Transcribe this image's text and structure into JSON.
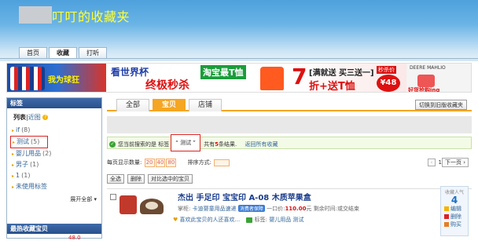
{
  "header": {
    "site_title": "叮叮的收藏夹",
    "nav": [
      "首页",
      "收藏",
      "打听"
    ]
  },
  "banner": {
    "ad1_text": "我为球狂",
    "ad2_line1": "看世界杯",
    "ad2_line2": "终极秒杀",
    "ad2_tag": "淘宝最T恤",
    "ad3_number": "7",
    "ad3_line1": "[满就送 买三送一]",
    "ad3_line2": "折+送T恤",
    "ad3_badge": "秒杀价",
    "ad3_price": "¥48",
    "ad4_brand": "DEERE MAHLIO",
    "ad4_cta": "好货抢购ing"
  },
  "sidebar": {
    "title": "标签",
    "view_list": "列表",
    "view_recent": "近图",
    "tags": [
      {
        "name": "if",
        "count": "(8)"
      },
      {
        "name": "测试",
        "count": "(5)"
      },
      {
        "name": "婴儿用品",
        "count": "(2)"
      },
      {
        "name": "男子",
        "count": "(1)"
      },
      {
        "name": "1",
        "count": "(1)"
      },
      {
        "name": "未使用标签",
        "count": ""
      }
    ],
    "expand_all": "展开全部",
    "section2_title": "最热收藏宝贝",
    "section2_price": "48.0"
  },
  "main": {
    "tabs": [
      "全部",
      "宝贝",
      "店铺"
    ],
    "switch_button": "切换到旧版收藏夹",
    "result_prefix": "您当前搜索的是 标签",
    "result_tag": "“ 测试 ”",
    "result_mid": "共有",
    "result_count": "5",
    "result_suffix": "条结果.",
    "result_back": "返回所有收藏",
    "per_page_label": "每页显示数量:",
    "per_page_options": [
      "20",
      "40",
      "80"
    ],
    "sort_label": "排序方式:",
    "page_prev": "‹",
    "page_num": "1",
    "page_next": "下一页",
    "select_all": "全选",
    "delete": "删除",
    "compare": "对比选中的宝贝",
    "item": {
      "title": "杰出 手足印 宝宝印 A-08 木质苹果盒",
      "seller_label": "掌柜:",
      "seller": "卡迪婴童用品速递",
      "cert": "消费者保障",
      "price_label": "一口价:",
      "price": "110.00",
      "price_unit": "元",
      "time_label": "剩余时间:",
      "time": "或交结束",
      "share": "喜欢此宝贝的人还喜欢...",
      "tag_label": "标签:",
      "tag1": "婴儿用品",
      "tag2": "测试",
      "popularity_label": "收藏人气",
      "popularity": "4",
      "op_edit": "编辑",
      "op_delete": "删除",
      "op_buy": "购买"
    }
  },
  "colors": {
    "accent": "#f5a623",
    "link": "#336699",
    "highlight": "#dd2222"
  }
}
